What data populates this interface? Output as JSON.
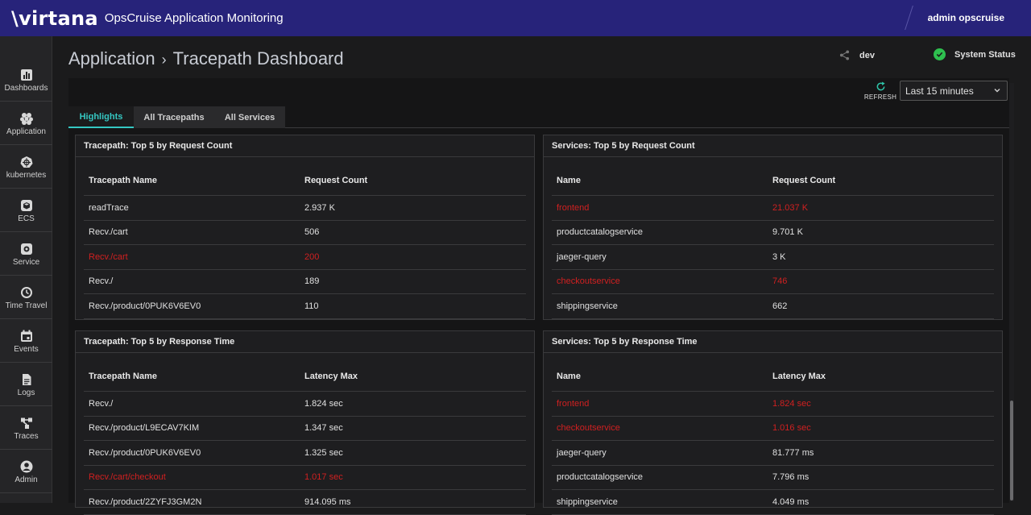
{
  "header": {
    "logo": "\\virtana",
    "app_title": "OpsCruise Application Monitoring",
    "user": "admin opscruise"
  },
  "sidebar": {
    "items": [
      {
        "label": "Dashboards",
        "icon": "bar-chart-icon"
      },
      {
        "label": "Application",
        "icon": "hexagon-cluster-icon"
      },
      {
        "label": "kubernetes",
        "icon": "kubernetes-helm-icon"
      },
      {
        "label": "ECS",
        "icon": "box-icon"
      },
      {
        "label": "Service",
        "icon": "service-gear-icon"
      },
      {
        "label": "Time Travel",
        "icon": "history-icon"
      },
      {
        "label": "Events",
        "icon": "calendar-icon"
      },
      {
        "label": "Logs",
        "icon": "document-icon"
      },
      {
        "label": "Traces",
        "icon": "flow-icon"
      },
      {
        "label": "Admin",
        "icon": "user-icon"
      }
    ]
  },
  "breadcrumb": {
    "parent": "Application",
    "separator": "›",
    "current": "Tracepath Dashboard"
  },
  "env": {
    "label": "dev"
  },
  "system_status": {
    "label": "System Status",
    "color": "#2ec04f"
  },
  "toolbar": {
    "refresh_label": "REFRESH",
    "time_range": "Last 15 minutes"
  },
  "tabs": [
    {
      "label": "Highlights",
      "active": true
    },
    {
      "label": "All Tracepaths",
      "active": false
    },
    {
      "label": "All Services",
      "active": false
    }
  ],
  "colors": {
    "accent": "#35c7c2",
    "alert": "#d02020",
    "header_bg": "#27237a"
  },
  "cards": {
    "tp_req": {
      "title": "Tracepath: Top 5 by Request Count",
      "columns": [
        "Tracepath Name",
        "Request Count"
      ],
      "rows": [
        {
          "name": "readTrace",
          "value": "2.937 K"
        },
        {
          "name": "Recv./cart",
          "value": "506"
        },
        {
          "name": "Recv./cart",
          "value": "200"
        },
        {
          "name": "Recv./",
          "value": "189"
        },
        {
          "name": "Recv./product/0PUK6V6EV0",
          "value": "110"
        }
      ]
    },
    "svc_req": {
      "title": "Services: Top 5 by Request Count",
      "columns": [
        "Name",
        "Request Count"
      ],
      "rows": [
        {
          "name": "frontend",
          "value": "21.037 K"
        },
        {
          "name": "productcatalogservice",
          "value": "9.701 K"
        },
        {
          "name": "jaeger-query",
          "value": "3 K"
        },
        {
          "name": "checkoutservice",
          "value": "746"
        },
        {
          "name": "shippingservice",
          "value": "662"
        }
      ]
    },
    "tp_resp": {
      "title": "Tracepath: Top 5 by Response Time",
      "columns": [
        "Tracepath Name",
        "Latency Max"
      ],
      "rows": [
        {
          "name": "Recv./",
          "value": "1.824 sec"
        },
        {
          "name": "Recv./product/L9ECAV7KIM",
          "value": "1.347 sec"
        },
        {
          "name": "Recv./product/0PUK6V6EV0",
          "value": "1.325 sec"
        },
        {
          "name": "Recv./cart/checkout",
          "value": "1.017 sec"
        },
        {
          "name": "Recv./product/2ZYFJ3GM2N",
          "value": "914.095 ms"
        }
      ]
    },
    "svc_resp": {
      "title": "Services: Top 5 by Response Time",
      "columns": [
        "Name",
        "Latency Max"
      ],
      "rows": [
        {
          "name": "frontend",
          "value": "1.824 sec"
        },
        {
          "name": "checkoutservice",
          "value": "1.016 sec"
        },
        {
          "name": "jaeger-query",
          "value": "81.777 ms"
        },
        {
          "name": "productcatalogservice",
          "value": "7.796 ms"
        },
        {
          "name": "shippingservice",
          "value": "4.049 ms"
        }
      ]
    }
  }
}
